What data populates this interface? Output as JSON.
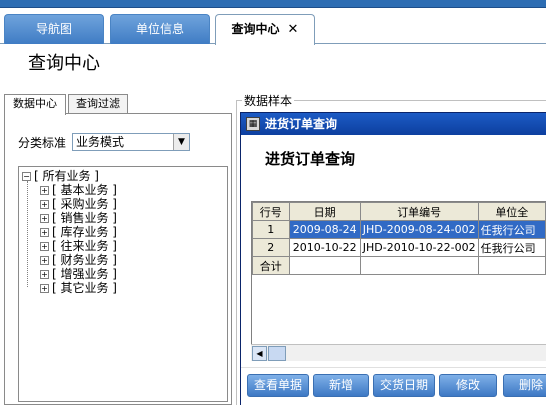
{
  "tabs": [
    {
      "label": "导航图"
    },
    {
      "label": "单位信息"
    },
    {
      "label": "查询中心",
      "active": true
    }
  ],
  "tab_close_glyph": "✕",
  "page_title": "查询中心",
  "left_panel": {
    "tabs": [
      {
        "label": "数据中心"
      },
      {
        "label": "查询过滤"
      }
    ],
    "category_label": "分类标准",
    "category_value": "业务模式",
    "tree": {
      "root": "[ 所有业务 ]",
      "children": [
        "[ 基本业务 ]",
        "[ 采购业务 ]",
        "[ 销售业务 ]",
        "[ 库存业务 ]",
        "[ 往来业务 ]",
        "[ 财务业务 ]",
        "[ 增强业务 ]",
        "[ 其它业务 ]"
      ]
    }
  },
  "sample_legend": "数据样本",
  "subwindow": {
    "title": "进货订单查询",
    "heading": "进货订单查询",
    "columns": [
      "行号",
      "日期",
      "订单编号",
      "单位全"
    ],
    "rows": [
      {
        "row_no": "1",
        "date": "2009-08-24",
        "order_no": "JHD-2009-08-24-002",
        "unit": "任我行公司"
      },
      {
        "row_no": "2",
        "date": "2010-10-22",
        "order_no": "JHD-2010-10-22-002",
        "unit": "任我行公司"
      }
    ],
    "total_label": "合计",
    "buttons": [
      "查看单据",
      "新增",
      "交货日期",
      "修改",
      "删除"
    ]
  },
  "colors": {
    "accent": "#3d78c4",
    "selection": "#316ac5",
    "titlebar": "#1c5bc5"
  },
  "icons": {
    "tab_close": "close-icon",
    "window": "window-icon",
    "scroll_left": "scroll-left-icon",
    "dropdown": "chevron-down-icon"
  }
}
